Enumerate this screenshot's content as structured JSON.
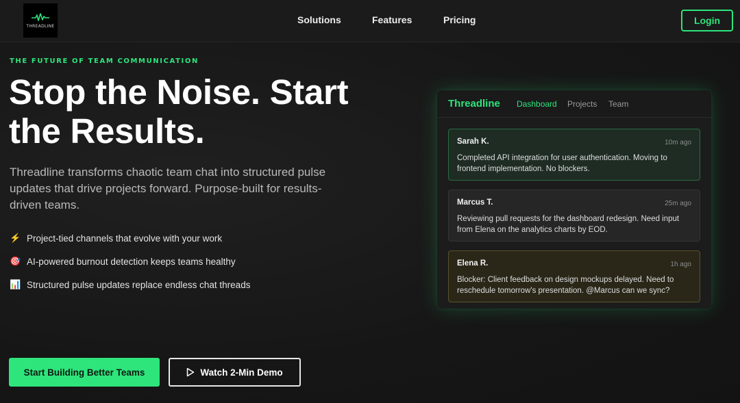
{
  "nav": {
    "logo_text": "THREADLINE",
    "links": [
      "Solutions",
      "Features",
      "Pricing"
    ],
    "login_label": "Login"
  },
  "hero": {
    "eyebrow": "THE FUTURE OF TEAM COMMUNICATION",
    "headline_line1": "Stop the Noise. Start",
    "headline_line2": "the Results.",
    "subtitle": "Threadline transforms chaotic team chat into structured pulse updates that drive projects forward. Purpose-built for results-driven teams.",
    "features": [
      {
        "icon": "⚡",
        "icon_name": "lightning-icon",
        "text": "Project-tied channels that evolve with your work"
      },
      {
        "icon": "🎯",
        "icon_name": "target-icon",
        "text": "AI-powered burnout detection keeps teams healthy"
      },
      {
        "icon": "📊",
        "icon_name": "bar-chart-icon",
        "text": "Structured pulse updates replace endless chat threads"
      }
    ],
    "cta_primary": "Start Building Better Teams",
    "cta_secondary": "Watch 2-Min Demo"
  },
  "preview": {
    "brand": "Threadline",
    "tabs": [
      "Dashboard",
      "Projects",
      "Team"
    ],
    "active_tab": "Dashboard",
    "messages": [
      {
        "author": "Sarah K.",
        "time": "10m ago",
        "text": "Completed API integration for user authentication. Moving to frontend implementation. No blockers.",
        "status": "green"
      },
      {
        "author": "Marcus T.",
        "time": "25m ago",
        "text": "Reviewing pull requests for the dashboard redesign. Need input from Elena on the analytics charts by EOD.",
        "status": "gray"
      },
      {
        "author": "Elena R.",
        "time": "1h ago",
        "text": "Blocker: Client feedback on design mockups delayed. Need to reschedule tomorrow's presentation. @Marcus can we sync?",
        "status": "amber"
      }
    ]
  },
  "colors": {
    "accent": "#2ee57c",
    "background": "#161616",
    "status_green": "#2a6b44",
    "status_gray": "#343434",
    "status_amber": "#5a5128"
  }
}
